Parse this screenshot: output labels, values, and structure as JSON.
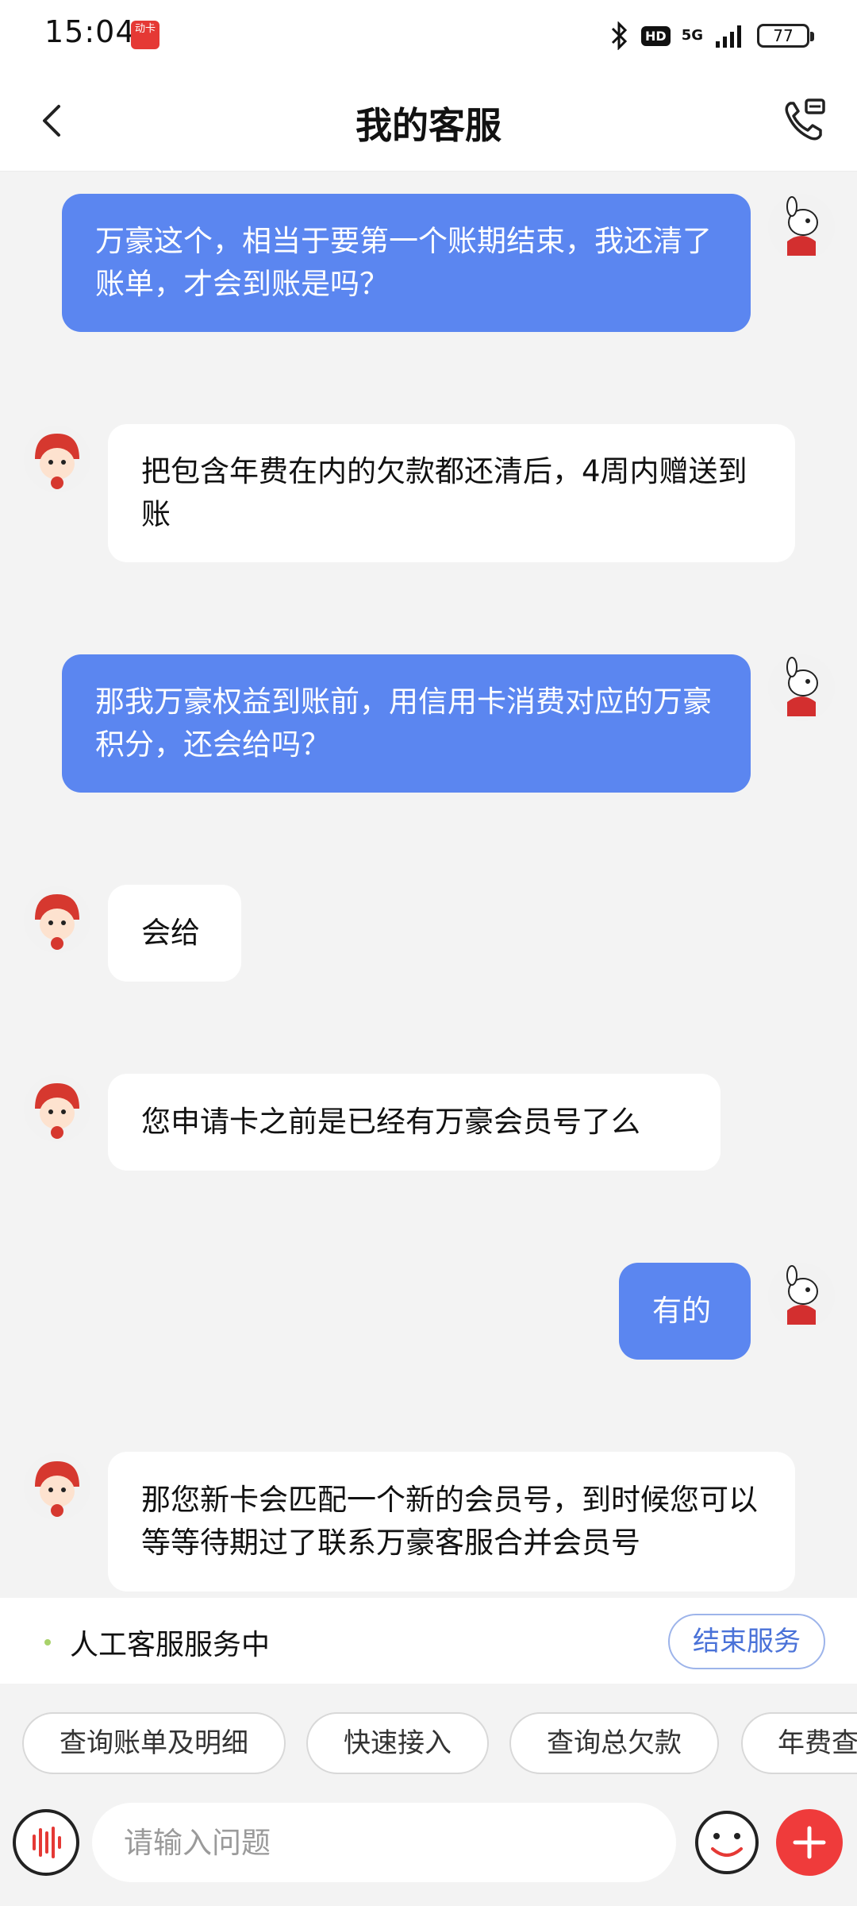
{
  "status_bar": {
    "time": "15:04",
    "app_icon_text": "动卡",
    "hd": "HD",
    "network": "5G",
    "battery": "77"
  },
  "header": {
    "title": "我的客服"
  },
  "messages": [
    {
      "sender": "user",
      "text": "万豪这个，相当于要第一个账期结束，我还清了账单，才会到账是吗？"
    },
    {
      "sender": "agent",
      "text": "把包含年费在内的欠款都还清后，4周内赠送到账"
    },
    {
      "sender": "user",
      "text": "那我万豪权益到账前，用信用卡消费对应的万豪积分，还会给吗？"
    },
    {
      "sender": "agent",
      "text": "会给"
    },
    {
      "sender": "agent",
      "text": "您申请卡之前是已经有万豪会员号了么"
    },
    {
      "sender": "user",
      "text": "有的"
    },
    {
      "sender": "agent",
      "text": "那您新卡会匹配一个新的会员号，到时候您可以等等待期过了联系万豪客服合并会员号"
    }
  ],
  "service": {
    "status_text": "人工客服服务中",
    "end_label": "结束服务"
  },
  "quick_replies": [
    "查询账单及明细",
    "快速接入",
    "查询总欠款",
    "年费查"
  ],
  "input": {
    "placeholder": "请输入问题"
  },
  "colors": {
    "user_bubble": "#5b86f0",
    "accent_red": "#ef3b3b",
    "service_dot": "#a8d26a"
  }
}
